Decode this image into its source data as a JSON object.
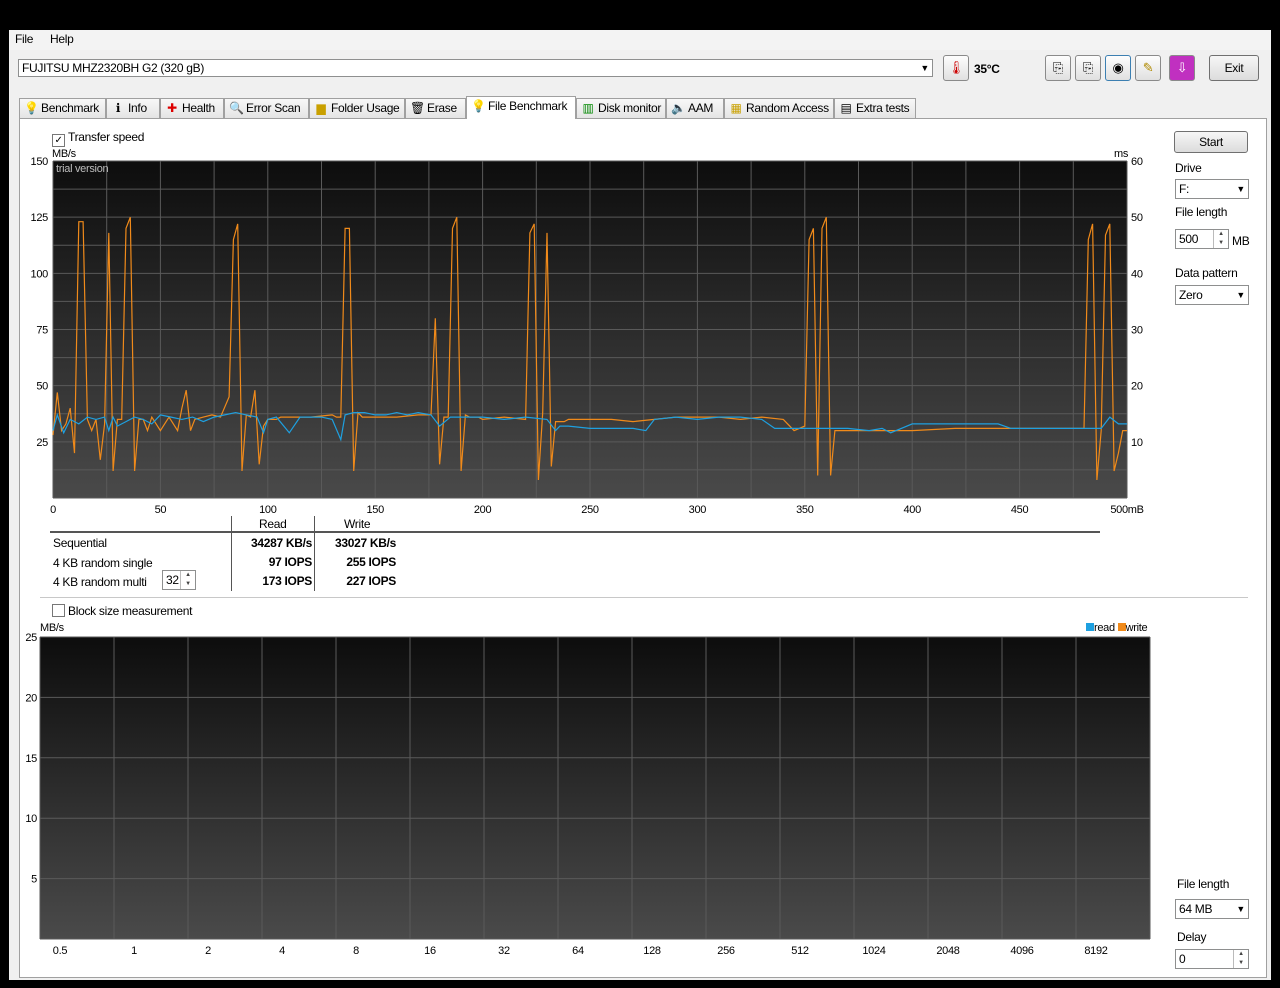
{
  "menu": {
    "file": "File",
    "help": "Help"
  },
  "toolbar": {
    "drive_select": "FUJITSU MHZ2320BH G2 (320 gB)",
    "temperature": "35°C",
    "exit_label": "Exit"
  },
  "tabs": [
    {
      "label": "Benchmark",
      "icon": "bulb-icon"
    },
    {
      "label": "Info",
      "icon": "info-icon"
    },
    {
      "label": "Health",
      "icon": "health-cross-icon"
    },
    {
      "label": "Error Scan",
      "icon": "magnifier-icon"
    },
    {
      "label": "Folder Usage",
      "icon": "folder-icon"
    },
    {
      "label": "Erase",
      "icon": "trash-icon"
    },
    {
      "label": "File Benchmark",
      "icon": "bulb-icon"
    },
    {
      "label": "Disk monitor",
      "icon": "chart-icon"
    },
    {
      "label": "AAM",
      "icon": "speaker-icon"
    },
    {
      "label": "Random Access",
      "icon": "grid-icon"
    },
    {
      "label": "Extra tests",
      "icon": "extra-icon"
    }
  ],
  "transfer": {
    "checkbox_label": "Transfer speed",
    "trial_text": "trial version"
  },
  "right_panel": {
    "start_label": "Start",
    "drive_label": "Drive",
    "drive_value": "F:",
    "file_length_label": "File length",
    "file_length_value": "500",
    "file_length_unit": "MB",
    "data_pattern_label": "Data pattern",
    "data_pattern_value": "Zero"
  },
  "results": {
    "read_header": "Read",
    "write_header": "Write",
    "rows": [
      {
        "label": "Sequential",
        "read": "34287 KB/s",
        "write": "33027 KB/s"
      },
      {
        "label": "4 KB random single",
        "read": "97 IOPS",
        "write": "255 IOPS"
      },
      {
        "label": "4 KB random multi",
        "read": "173 IOPS",
        "write": "227 IOPS"
      }
    ],
    "queue_depth": "32"
  },
  "block": {
    "checkbox_label": "Block size measurement",
    "file_length_label": "File length",
    "file_length_value": "64 MB",
    "delay_label": "Delay",
    "delay_value": "0"
  },
  "colors": {
    "read": "#1ea0e0",
    "write": "#f08a1a"
  },
  "chart_data": [
    {
      "type": "line",
      "y_unit_left": "MB/s",
      "y_unit_right": "ms",
      "xlim": [
        0,
        500
      ],
      "ylim": [
        0,
        150
      ],
      "ylim_right": [
        0,
        60
      ],
      "x_ticks": [
        "0",
        "50",
        "100",
        "150",
        "200",
        "250",
        "300",
        "350",
        "400",
        "450",
        "500mB"
      ],
      "y_ticks": [
        "25",
        "50",
        "75",
        "100",
        "125",
        "150"
      ],
      "y_ticks_right": [
        "10",
        "20",
        "30",
        "40",
        "50",
        "60"
      ],
      "series": [
        {
          "name": "read",
          "x": [
            0,
            2,
            5,
            8,
            12,
            16,
            20,
            24,
            26,
            28,
            30,
            34,
            38,
            42,
            46,
            50,
            55,
            60,
            65,
            70,
            75,
            80,
            85,
            90,
            95,
            98,
            100,
            104,
            110,
            115,
            120,
            125,
            130,
            134,
            136,
            140,
            145,
            150,
            155,
            160,
            165,
            170,
            176,
            180,
            185,
            190,
            200,
            210,
            220,
            230,
            234,
            236,
            240,
            250,
            260,
            270,
            276,
            280,
            290,
            300,
            310,
            320,
            330,
            336,
            340,
            350,
            360,
            370,
            380,
            386,
            390,
            400,
            420,
            440,
            446,
            450,
            460,
            470,
            480,
            484,
            488,
            492,
            496,
            500
          ],
          "y": [
            30,
            37,
            29,
            35,
            33,
            36,
            35,
            36,
            30,
            36,
            32,
            34,
            36,
            35,
            33,
            37,
            36,
            35,
            36,
            34,
            36,
            37,
            38,
            37,
            36,
            29,
            35,
            36,
            29,
            36,
            36,
            36,
            35,
            26,
            37,
            38,
            38,
            37,
            37,
            38,
            37,
            38,
            37,
            32,
            36,
            36,
            36,
            35,
            36,
            35,
            30,
            32,
            32,
            31,
            31,
            31,
            30,
            35,
            36,
            35,
            36,
            36,
            35,
            31,
            31,
            31,
            31,
            31,
            30,
            31,
            29,
            33,
            33,
            33,
            31,
            31,
            31,
            31,
            31,
            31,
            31,
            36,
            33,
            33
          ]
        },
        {
          "name": "write",
          "x": [
            0,
            2,
            4,
            6,
            8,
            10,
            12,
            14,
            16,
            18,
            20,
            22,
            24,
            26,
            28,
            30,
            32,
            34,
            36,
            38,
            40,
            42,
            44,
            46,
            50,
            54,
            58,
            60,
            62,
            64,
            66,
            70,
            74,
            78,
            82,
            84,
            86,
            88,
            90,
            92,
            94,
            96,
            98,
            100,
            102,
            104,
            106,
            110,
            120,
            130,
            132,
            134,
            136,
            138,
            140,
            142,
            144,
            146,
            148,
            150,
            160,
            170,
            176,
            178,
            180,
            182,
            184,
            186,
            188,
            190,
            192,
            194,
            196,
            198,
            200,
            210,
            220,
            222,
            224,
            226,
            228,
            230,
            232,
            234,
            236,
            238,
            240,
            250,
            260,
            270,
            280,
            290,
            300,
            310,
            320,
            330,
            340,
            345,
            350,
            352,
            354,
            356,
            358,
            360,
            362,
            364,
            366,
            368,
            370,
            380,
            390,
            400,
            420,
            440,
            460,
            470,
            476,
            478,
            480,
            482,
            484,
            486,
            488,
            490,
            492,
            494,
            496,
            498,
            500
          ],
          "y": [
            28,
            47,
            30,
            33,
            40,
            20,
            123,
            123,
            35,
            30,
            35,
            17,
            33,
            118,
            12,
            35,
            35,
            120,
            125,
            12,
            35,
            35,
            30,
            36,
            30,
            36,
            30,
            40,
            48,
            30,
            35,
            36,
            37,
            36,
            45,
            115,
            122,
            12,
            37,
            36,
            48,
            15,
            32,
            35,
            35,
            35,
            36,
            36,
            36,
            37,
            36,
            36,
            120,
            120,
            12,
            38,
            36,
            36,
            36,
            36,
            36,
            37,
            37,
            80,
            15,
            36,
            36,
            120,
            125,
            12,
            37,
            36,
            36,
            36,
            35,
            36,
            35,
            118,
            122,
            8,
            38,
            118,
            14,
            34,
            34,
            34,
            35,
            35,
            35,
            34,
            35,
            36,
            36,
            36,
            35,
            36,
            35,
            30,
            32,
            115,
            120,
            10,
            120,
            125,
            10,
            30,
            30,
            30,
            30,
            30,
            30,
            30,
            31,
            31,
            31,
            31,
            31,
            31,
            31,
            115,
            122,
            8,
            30,
            117,
            122,
            12,
            20,
            30,
            30
          ]
        }
      ]
    },
    {
      "type": "bar",
      "y_unit": "MB/s",
      "ylim": [
        0,
        25
      ],
      "categories": [
        "0.5",
        "1",
        "2",
        "4",
        "8",
        "16",
        "32",
        "64",
        "128",
        "256",
        "512",
        "1024",
        "2048",
        "4096",
        "8192"
      ],
      "y_ticks": [
        "5",
        "10",
        "15",
        "20",
        "25"
      ],
      "legend": [
        "read",
        "write"
      ],
      "legend_position": "top-right",
      "series": [
        {
          "name": "read",
          "values": []
        },
        {
          "name": "write",
          "values": []
        }
      ]
    }
  ]
}
